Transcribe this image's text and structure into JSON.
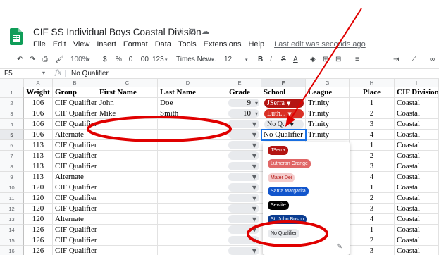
{
  "doc": {
    "title": "CIF SS Individual Boys Coastal Division",
    "title_icons": [
      "☆",
      "⊡",
      "☁"
    ],
    "last_edit": "Last edit was seconds ago"
  },
  "menu": [
    "File",
    "Edit",
    "View",
    "Insert",
    "Format",
    "Data",
    "Tools",
    "Extensions",
    "Help"
  ],
  "toolbar": {
    "zoom": "100%",
    "currency": "$",
    "percent": "%",
    "dec_less": ".0",
    "dec_more": ".00",
    "format_more": "123",
    "font": "Times New...",
    "font_size": "12",
    "bold": "B",
    "italic": "I",
    "strike": "S",
    "text_color": "A"
  },
  "formula_bar": {
    "cell_ref": "F5",
    "fx": "fx",
    "value": "No Qualifier"
  },
  "columns": [
    "A",
    "B",
    "C",
    "D",
    "E",
    "F",
    "G",
    "H",
    "I"
  ],
  "header_row": [
    "Weight",
    "Group",
    "First Name",
    "Last Name",
    "Grade",
    "School",
    "League",
    "Place",
    "CIF Division"
  ],
  "rows": [
    {
      "num": "2",
      "weight": "106",
      "group": "CIF Qualifier",
      "first": "John",
      "last": "Doe",
      "grade": "9",
      "school": "JSerra",
      "league": "Trinity",
      "place": "1",
      "division": "Coastal"
    },
    {
      "num": "3",
      "weight": "106",
      "group": "CIF Qualifier",
      "first": "Mike",
      "last": "Smith",
      "grade": "10",
      "school": "Luth...",
      "league": "Trinity",
      "place": "2",
      "division": "Coastal"
    },
    {
      "num": "4",
      "weight": "106",
      "group": "CIF Qualifier",
      "first": "",
      "last": "",
      "grade": "",
      "school": "No Q...",
      "league": "Trinity",
      "place": "3",
      "division": "Coastal"
    },
    {
      "num": "5",
      "weight": "106",
      "group": "Alternate",
      "first": "",
      "last": "",
      "grade": "",
      "school": "No Qualifier",
      "league": "Trinity",
      "place": "4",
      "division": "Coastal"
    },
    {
      "num": "6",
      "weight": "113",
      "group": "CIF Qualifier",
      "first": "",
      "last": "",
      "grade": "",
      "school": "",
      "league": "",
      "place": "1",
      "division": "Coastal"
    },
    {
      "num": "7",
      "weight": "113",
      "group": "CIF Qualifier",
      "first": "",
      "last": "",
      "grade": "",
      "school": "",
      "league": "",
      "place": "2",
      "division": "Coastal"
    },
    {
      "num": "8",
      "weight": "113",
      "group": "CIF Qualifier",
      "first": "",
      "last": "",
      "grade": "",
      "school": "",
      "league": "",
      "place": "3",
      "division": "Coastal"
    },
    {
      "num": "9",
      "weight": "113",
      "group": "Alternate",
      "first": "",
      "last": "",
      "grade": "",
      "school": "",
      "league": "",
      "place": "4",
      "division": "Coastal"
    },
    {
      "num": "10",
      "weight": "120",
      "group": "CIF Qualifier",
      "first": "",
      "last": "",
      "grade": "",
      "school": "",
      "league": "",
      "place": "1",
      "division": "Coastal"
    },
    {
      "num": "11",
      "weight": "120",
      "group": "CIF Qualifier",
      "first": "",
      "last": "",
      "grade": "",
      "school": "",
      "league": "",
      "place": "2",
      "division": "Coastal"
    },
    {
      "num": "12",
      "weight": "120",
      "group": "CIF Qualifier",
      "first": "",
      "last": "",
      "grade": "",
      "school": "",
      "league": "",
      "place": "3",
      "division": "Coastal"
    },
    {
      "num": "13",
      "weight": "120",
      "group": "Alternate",
      "first": "",
      "last": "",
      "grade": "",
      "school": "",
      "league": "",
      "place": "4",
      "division": "Coastal"
    },
    {
      "num": "14",
      "weight": "126",
      "group": "CIF Qualifier",
      "first": "",
      "last": "",
      "grade": "",
      "school": "",
      "league": "",
      "place": "1",
      "division": "Coastal"
    },
    {
      "num": "15",
      "weight": "126",
      "group": "CIF Qualifier",
      "first": "",
      "last": "",
      "grade": "",
      "school": "",
      "league": "",
      "place": "2",
      "division": "Coastal"
    },
    {
      "num": "16",
      "weight": "126",
      "group": "CIF Qualifier",
      "first": "",
      "last": "",
      "grade": "",
      "school": "",
      "league": "",
      "place": "3",
      "division": "Coastal"
    }
  ],
  "school_chip_colors": {
    "JSerra": "#b31412",
    "Luth...": "#d93025",
    "No Q...": "#e8eaed"
  },
  "dropdown_options": [
    {
      "label": "JSerra",
      "bg": "#b31412",
      "fg": "#ffffff"
    },
    {
      "label": "Lutheran Orange",
      "bg": "#e06666",
      "fg": "#ffffff"
    },
    {
      "label": "Mater Dei",
      "bg": "#f4cccc",
      "fg": "#b31412"
    },
    {
      "label": "Santa Margarita",
      "bg": "#1155cc",
      "fg": "#ffffff"
    },
    {
      "label": "Servite",
      "bg": "#000000",
      "fg": "#ffffff"
    },
    {
      "label": "St. John Bosco",
      "bg": "#0b3d91",
      "fg": "#ffffff"
    },
    {
      "label": "No Qualifier",
      "bg": "#e8eaed",
      "fg": "#202124"
    }
  ],
  "colors": {
    "selection_blue": "#1a73e8",
    "annotation_red": "#e00000",
    "sheets_green": "#0f9d58"
  }
}
